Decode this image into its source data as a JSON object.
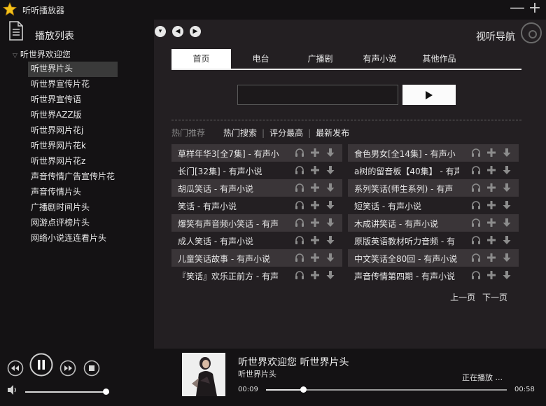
{
  "app": {
    "title": "听听播放器",
    "minimize_glyph": "—",
    "maximize_glyph": "+"
  },
  "sidebar": {
    "title": "播放列表",
    "root_label": "听世界欢迎您",
    "items": [
      {
        "label": "听世界片头",
        "active": true
      },
      {
        "label": "听世界宣传片花"
      },
      {
        "label": "听世界宣传语"
      },
      {
        "label": "听世界AZZ版"
      },
      {
        "label": "听世界网片花j"
      },
      {
        "label": "听世界网片花k"
      },
      {
        "label": "听世界网片花z"
      },
      {
        "label": "声音传情广告宣传片花"
      },
      {
        "label": "声音传情片头"
      },
      {
        "label": "广播剧时间片头"
      },
      {
        "label": "网游点评榜片头"
      },
      {
        "label": "网络小说连连看片头"
      }
    ]
  },
  "header": {
    "nav_down": "▾",
    "nav_back": "◀",
    "nav_forward": "▶",
    "guide_label": "视听导航"
  },
  "tabs": [
    {
      "label": "首页",
      "active": true
    },
    {
      "label": "电台"
    },
    {
      "label": "广播剧"
    },
    {
      "label": "有声小说"
    },
    {
      "label": "其他作品"
    }
  ],
  "search": {
    "value": "",
    "placeholder": ""
  },
  "filters": {
    "heading": "热门推荐",
    "options": [
      "热门搜索",
      "评分最高",
      "最新发布"
    ],
    "separator": "|"
  },
  "results": [
    [
      "草样年华3[全7集] - 有声小",
      "食色男女[全14集] - 有声小"
    ],
    [
      "长门[32集] - 有声小说",
      "a树的留音板【40集】 - 有声"
    ],
    [
      "胡瓜笑话 - 有声小说",
      "系列笑话(师生系列) - 有声"
    ],
    [
      "笑话 - 有声小说",
      "短笑话 - 有声小说"
    ],
    [
      "爆笑有声音频小笑话 - 有声",
      "木成讲笑话 - 有声小说"
    ],
    [
      "成人笑话 - 有声小说",
      "原版英语教材听力音频 - 有"
    ],
    [
      "儿童笑话故事 - 有声小说",
      "中文笑话全80回 - 有声小说"
    ],
    [
      "『笑话』欢乐正前方 - 有声",
      "声音传情第四期 - 有声小说"
    ]
  ],
  "pager": {
    "prev": "上一页",
    "next": "下一页"
  },
  "player": {
    "title": "听世界欢迎您  听世界片头",
    "subtitle": "听世界片头",
    "status": "正在播放 ...",
    "current_time": "00:09",
    "total_time": "00:58",
    "progress": 0.155,
    "volume": 0.96
  },
  "colors": {
    "background": "#141214",
    "panel": "#231f22",
    "stripe": "#3a3538",
    "text": "#e6e6e6"
  }
}
